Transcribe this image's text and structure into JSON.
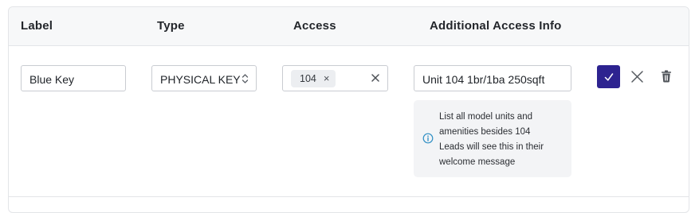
{
  "header": {
    "label": "Label",
    "type": "Type",
    "access": "Access",
    "additional_info": "Additional Access Info"
  },
  "row": {
    "label_value": "Blue Key",
    "type_value": "PHYSICAL KEY",
    "access_chip": "104",
    "additional_info_value": "Unit 104 1br/1ba 250sqft",
    "help_lines": [
      "List all model units and",
      "amenities besides 104",
      "Leads will see this in their",
      "welcome message"
    ]
  },
  "actions": {
    "confirm_icon": "check-icon",
    "cancel_icon": "close-icon",
    "delete_icon": "trash-icon"
  },
  "colors": {
    "accent": "#2d2390",
    "info_icon": "#2f8fc4",
    "border": "#c9ccd1"
  }
}
